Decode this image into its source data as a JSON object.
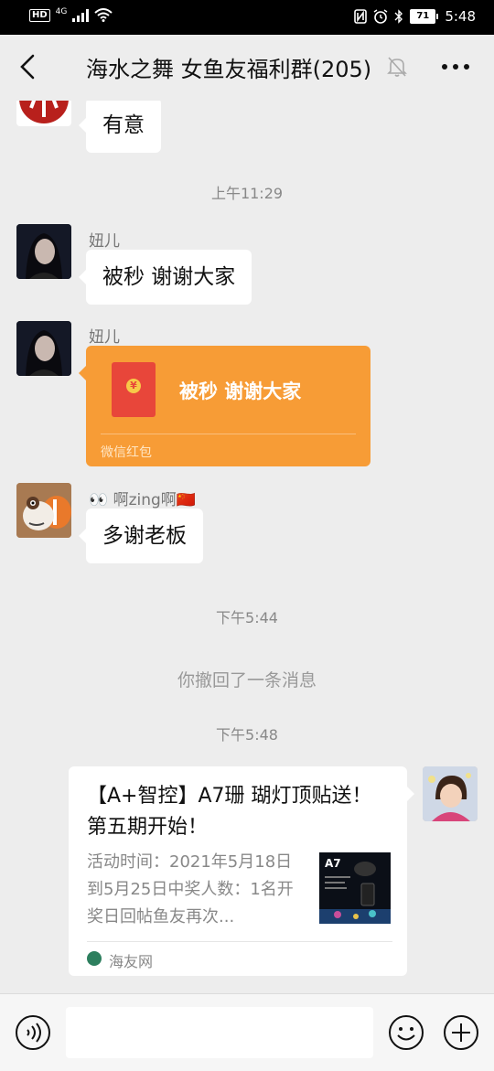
{
  "status_bar": {
    "hd": "HD",
    "network": "4G",
    "battery": "71",
    "time": "5:48"
  },
  "header": {
    "title": "海水之舞 女鱼友福利群(205)",
    "icons": [
      "back-arrow-icon",
      "mute-bell-icon",
      "more-dots-icon"
    ]
  },
  "messages": [
    {
      "type": "text",
      "text": "有意",
      "avatar": "red-logo-avatar"
    },
    {
      "type": "time",
      "text": "上午11:29"
    },
    {
      "type": "text",
      "sender": "妞儿",
      "text": "被秒 谢谢大家",
      "avatar": "woman-avatar"
    },
    {
      "type": "red_packet",
      "sender": "妞儿",
      "text": "被秒 谢谢大家",
      "label": "微信红包",
      "avatar": "woman-avatar"
    },
    {
      "type": "text",
      "sender": "👀 啊zing啊🇨🇳",
      "text": "多谢老板",
      "avatar": "cartoon-fish-avatar"
    },
    {
      "type": "time",
      "text": "下午5:44"
    },
    {
      "type": "system",
      "text": "你撤回了一条消息"
    },
    {
      "type": "time",
      "text": "下午5:48"
    },
    {
      "type": "link_card",
      "title": "【A+智控】A7珊 瑚灯顶贴送！第五期开始！",
      "desc": "活动时间：2021年5月18日到5月25日中奖人数：1名开奖日回帖鱼友再次...",
      "source": "海友网",
      "thumb_label": "A7",
      "avatar": "girl-avatar"
    }
  ],
  "input_bar": {
    "placeholder": "",
    "icons": [
      "voice-icon",
      "emoji-icon",
      "plus-icon"
    ]
  },
  "colors": {
    "background": "#ededed",
    "red_packet": "#f79c36",
    "bubble": "#ffffff"
  }
}
